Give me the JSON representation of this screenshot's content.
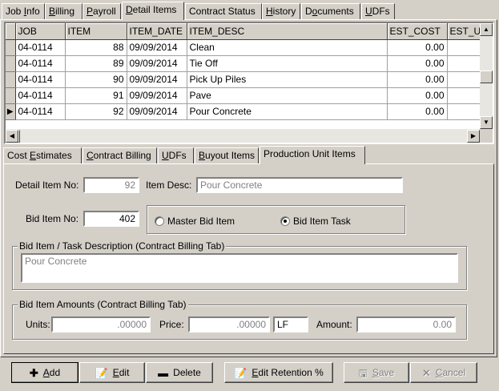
{
  "top_tabs": [
    {
      "label": "Job Info",
      "acc": "I",
      "pre": "Job ",
      "post": "nfo"
    },
    {
      "label": "Billing",
      "acc": "B",
      "pre": "",
      "post": "illing"
    },
    {
      "label": "Payroll",
      "acc": "P",
      "pre": "",
      "post": "ayroll"
    },
    {
      "label": "Detail Items",
      "acc": "D",
      "pre": "",
      "post": "etail Items"
    },
    {
      "label": "Contract Status",
      "acc": "",
      "pre": "Contract Status",
      "post": ""
    },
    {
      "label": "History",
      "acc": "H",
      "pre": "",
      "post": "istory"
    },
    {
      "label": "Documents",
      "acc": "o",
      "pre": "D",
      "post": "cuments"
    },
    {
      "label": "UDFs",
      "acc": "U",
      "pre": "",
      "post": "DFs"
    }
  ],
  "grid": {
    "columns": [
      "JOB",
      "ITEM",
      "ITEM_DATE",
      "ITEM_DESC",
      "EST_COST",
      "EST_UN"
    ],
    "rows": [
      {
        "job": "04-0114",
        "item": "88",
        "date": "09/09/2014",
        "desc": "Clean",
        "cost": "0.00",
        "cur": ""
      },
      {
        "job": "04-0114",
        "item": "89",
        "date": "09/09/2014",
        "desc": "Tie Off",
        "cost": "0.00",
        "cur": ""
      },
      {
        "job": "04-0114",
        "item": "90",
        "date": "09/09/2014",
        "desc": "Pick Up Piles",
        "cost": "0.00",
        "cur": ""
      },
      {
        "job": "04-0114",
        "item": "91",
        "date": "09/09/2014",
        "desc": "Pave",
        "cost": "0.00",
        "cur": ""
      },
      {
        "job": "04-0114",
        "item": "92",
        "date": "09/09/2014",
        "desc": "Pour Concrete",
        "cost": "0.00",
        "cur": "▶"
      }
    ]
  },
  "sub_tabs": [
    {
      "pre": "Cost ",
      "acc": "E",
      "post": "stimates"
    },
    {
      "pre": "",
      "acc": "C",
      "post": "ontract Billing"
    },
    {
      "pre": "",
      "acc": "U",
      "post": "DFs"
    },
    {
      "pre": "",
      "acc": "B",
      "post": "uyout Items"
    },
    {
      "pre": "Production Unit Items",
      "acc": "",
      "post": ""
    }
  ],
  "form": {
    "detail_item_no_label": "Detail Item No:",
    "detail_item_no": "92",
    "item_desc_label": "Item Desc:",
    "item_desc": "Pour Concrete",
    "bid_item_no_label": "Bid Item No:",
    "bid_item_no": "402",
    "radio_master": "Master Bid Item",
    "radio_task": "Bid Item Task",
    "task_desc_group": "Bid Item / Task Description (Contract Billing Tab)",
    "task_desc": "Pour Concrete",
    "amounts_group": "Bid Item Amounts (Contract Billing Tab)",
    "units_label": "Units:",
    "units": ".00000",
    "price_label": "Price:",
    "price": ".00000",
    "uom": "LF",
    "amount_label": "Amount:",
    "amount": "0.00"
  },
  "buttons": {
    "add": {
      "icon": "plus-icon",
      "pre": "",
      "acc": "A",
      "post": "dd"
    },
    "edit": {
      "icon": "edit-icon",
      "pre": "",
      "acc": "E",
      "post": "dit"
    },
    "delete": {
      "icon": "minus-icon",
      "pre": "Delete",
      "acc": "",
      "post": ""
    },
    "edit_retention": {
      "icon": "edit-icon",
      "pre": "",
      "acc": "E",
      "post": "dit Retention %"
    },
    "save": {
      "icon": "floppy-icon",
      "pre": "",
      "acc": "S",
      "post": "ave"
    },
    "cancel": {
      "icon": "cancel-icon",
      "pre": "",
      "acc": "C",
      "post": "ancel"
    }
  }
}
